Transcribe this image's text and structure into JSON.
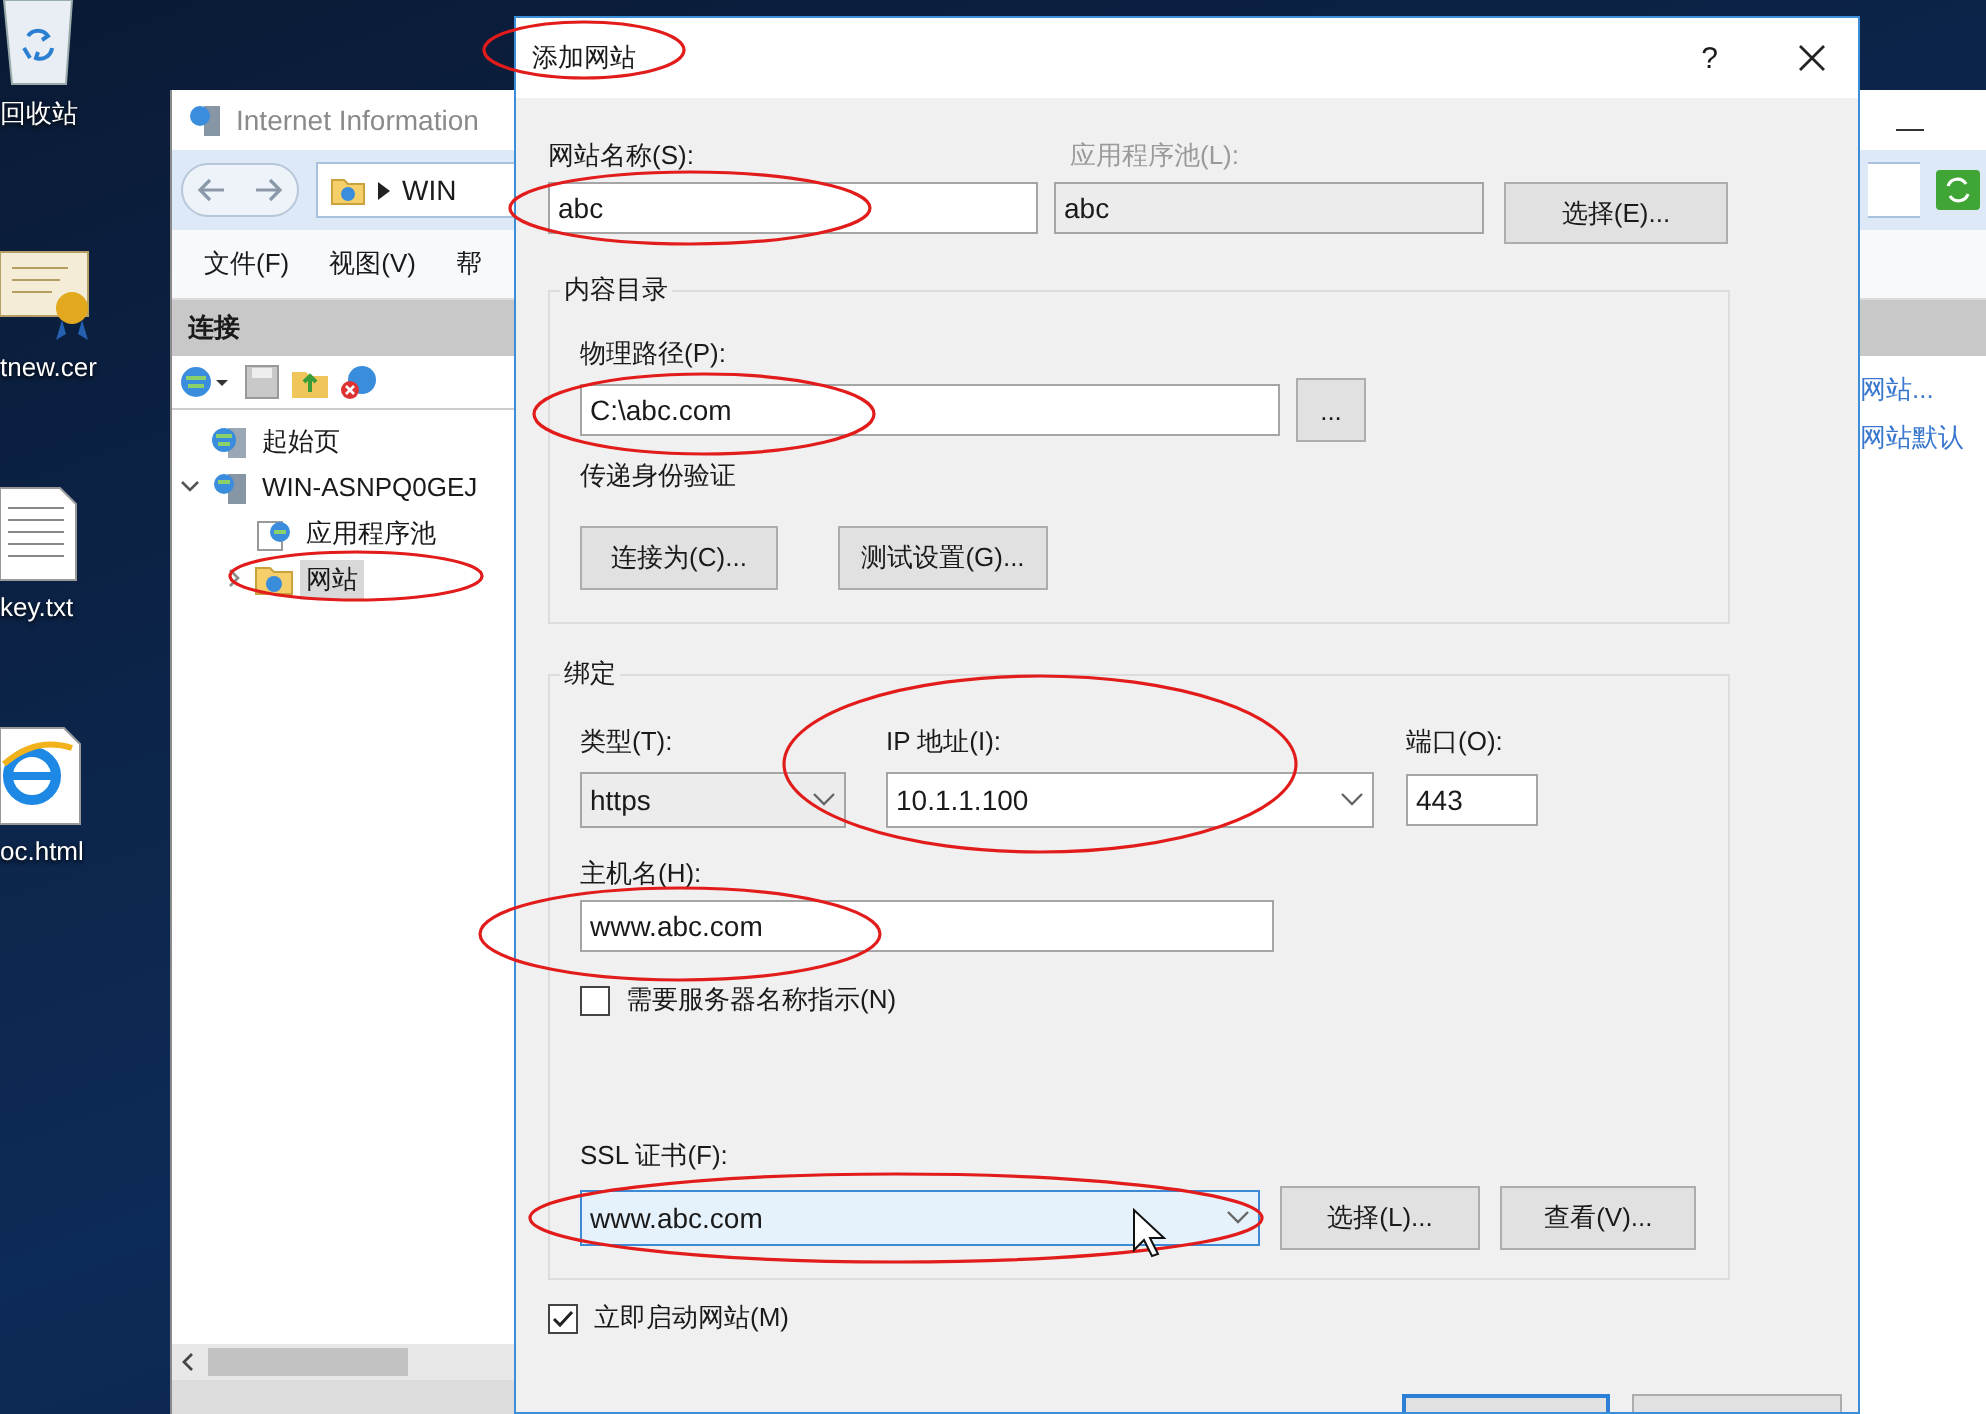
{
  "desktop_icons": [
    {
      "label": "回收站",
      "kind": "recycle-bin"
    },
    {
      "label": "tnew.cer",
      "kind": "certificate"
    },
    {
      "label": "key.txt",
      "kind": "text-file"
    },
    {
      "label": "oc.html",
      "kind": "browser"
    }
  ],
  "iis_window": {
    "title": "Internet Information",
    "address": "WIN",
    "menu": [
      "文件(F)",
      "视图(V)",
      "帮"
    ],
    "connections_title": "连接",
    "tree": [
      {
        "label": "起始页",
        "kind": "home",
        "selected": false
      },
      {
        "label": "WIN-ASNPQ0GEJ",
        "kind": "server",
        "selected": false,
        "expanded": true,
        "children": [
          {
            "label": "应用程序池",
            "kind": "pool",
            "selected": false
          },
          {
            "label": "网站",
            "kind": "sites",
            "selected": true,
            "expanded": false
          }
        ]
      }
    ],
    "actions": [
      "网站...",
      "网站默认"
    ]
  },
  "dialog": {
    "title": "添加网站",
    "help": "?",
    "site_name": {
      "label": "网站名称(S):",
      "value": "abc"
    },
    "app_pool": {
      "label": "应用程序池(L):",
      "value": "abc",
      "disabled": true
    },
    "select_pool_button": "选择(E)...",
    "content_directory": {
      "title": "内容目录",
      "physical_path": {
        "label": "物理路径(P):",
        "value": "C:\\abc.com"
      },
      "browse_button": "...",
      "auth_label": "传递身份验证",
      "connect_button": "连接为(C)...",
      "test_button": "测试设置(G)..."
    },
    "binding": {
      "title": "绑定",
      "type": {
        "label": "类型(T):",
        "value": "https"
      },
      "ip": {
        "label": "IP 地址(I):",
        "value": "10.1.1.100"
      },
      "port": {
        "label": "端口(O):",
        "value": "443"
      },
      "host": {
        "label": "主机名(H):",
        "value": "www.abc.com"
      },
      "sni": {
        "label": "需要服务器名称指示(N)",
        "checked": false
      },
      "ssl": {
        "label": "SSL 证书(F):",
        "value": "www.abc.com",
        "focused": true
      },
      "ssl_select_button": "选择(L)...",
      "ssl_view_button": "查看(V)..."
    },
    "start_now": {
      "label": "立即启动网站(M)",
      "checked": true
    }
  }
}
